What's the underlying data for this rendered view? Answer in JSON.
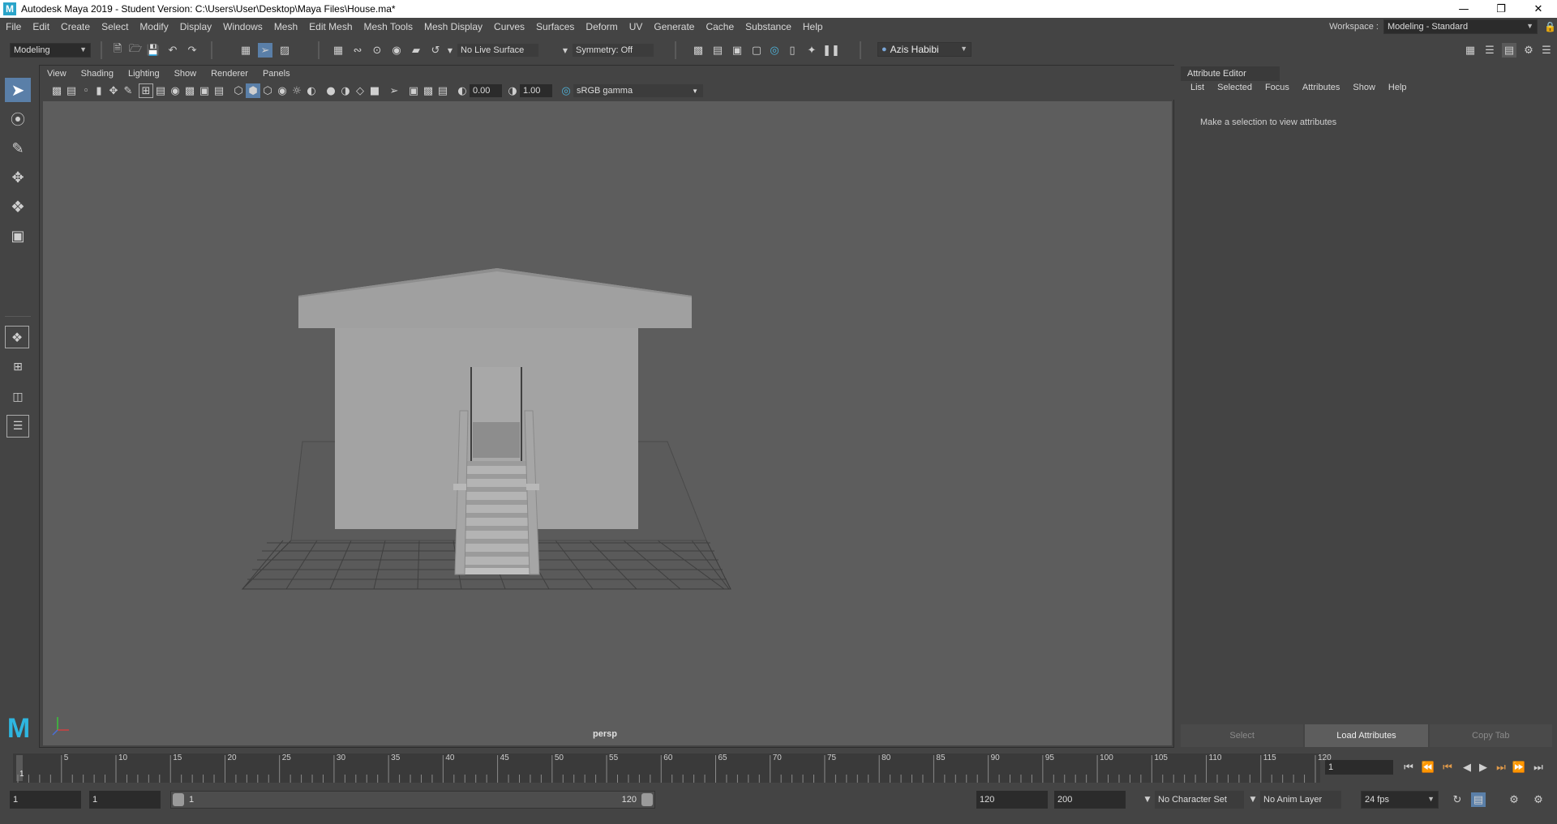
{
  "window": {
    "title": "Autodesk Maya 2019 - Student Version: C:\\Users\\User\\Desktop\\Maya Files\\House.ma*",
    "logo": "M",
    "controls": [
      "minimize-icon",
      "restore-icon",
      "close-icon"
    ]
  },
  "menubar": {
    "items": [
      "File",
      "Edit",
      "Create",
      "Select",
      "Modify",
      "Display",
      "Windows",
      "Mesh",
      "Edit Mesh",
      "Mesh Tools",
      "Mesh Display",
      "Curves",
      "Surfaces",
      "Deform",
      "UV",
      "Generate",
      "Cache",
      "Substance",
      "Help"
    ],
    "workspace_label": "Workspace :",
    "workspace_value": "Modeling - Standard"
  },
  "statusline": {
    "mode": "Modeling",
    "live_surface": "No Live Surface",
    "symmetry": "Symmetry: Off",
    "user": "Azis Habibi"
  },
  "panel": {
    "menu": [
      "View",
      "Shading",
      "Lighting",
      "Show",
      "Renderer",
      "Panels"
    ],
    "exposure": "0.00",
    "gamma": "1.00",
    "color_space": "sRGB gamma",
    "camera_label": "persp"
  },
  "attribute_editor": {
    "title": "Attribute Editor",
    "menu": [
      "List",
      "Selected",
      "Focus",
      "Attributes",
      "Show",
      "Help"
    ],
    "hint": "Make a selection to view attributes",
    "buttons": [
      "Select",
      "Load Attributes",
      "Copy Tab"
    ]
  },
  "timeline": {
    "ticks": [
      "5",
      "10",
      "15",
      "20",
      "25",
      "30",
      "35",
      "40",
      "45",
      "50",
      "55",
      "60",
      "65",
      "70",
      "75",
      "80",
      "85",
      "90",
      "95",
      "100",
      "105",
      "110",
      "115",
      "120"
    ],
    "current_marker": "1",
    "current_frame": "1"
  },
  "range": {
    "start": "1",
    "playback_start": "1",
    "slider_start": "1",
    "slider_end": "120",
    "playback_end": "120",
    "end": "200",
    "character_set": "No Character Set",
    "anim_layer": "No Anim Layer",
    "fps": "24 fps"
  }
}
